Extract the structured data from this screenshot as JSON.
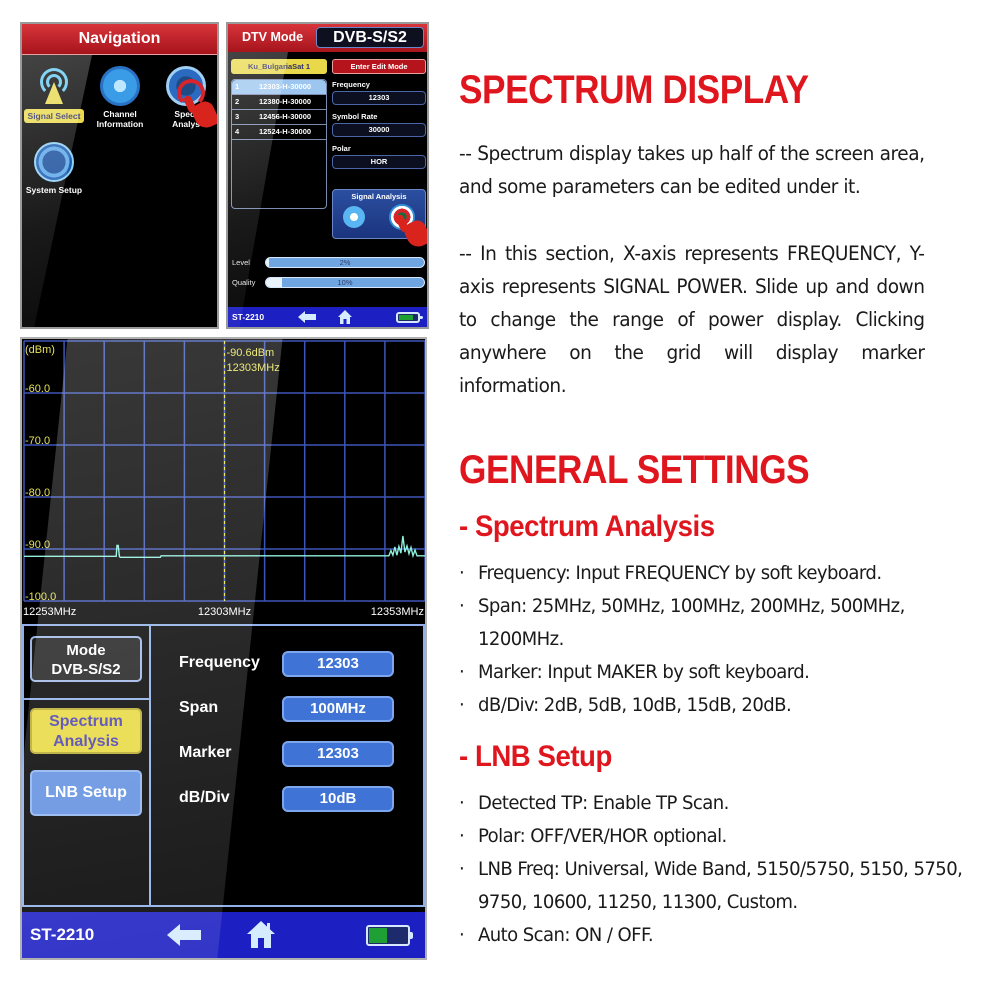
{
  "navigation_screen": {
    "title": "Navigation",
    "items": [
      {
        "label": "Signal Select",
        "icon": "antenna-icon",
        "selected": true
      },
      {
        "label": "Channel Information",
        "icon": "gear-icon",
        "selected": false
      },
      {
        "label": "Spectrum Analysis",
        "icon": "spectrum-icon",
        "selected": false
      },
      {
        "label": "System Setup",
        "icon": "options-icon",
        "selected": false
      }
    ],
    "label_lines": {
      "channel_1": "Channel",
      "channel_2": "Information",
      "spectrum_1": "Spect",
      "spectrum_2": "Analys"
    }
  },
  "dtv_screen": {
    "mode_label": "DTV Mode",
    "mode_value": "DVB-S/S2",
    "satellite": "Ku_BulgariaSat 1",
    "edit_button": "Enter Edit Mode",
    "transponders": [
      {
        "num": "1",
        "value": "12303-H-30000",
        "selected": true
      },
      {
        "num": "2",
        "value": "12380-H-30000",
        "selected": false
      },
      {
        "num": "3",
        "value": "12456-H-30000",
        "selected": false
      },
      {
        "num": "4",
        "value": "12524-H-30000",
        "selected": false
      }
    ],
    "frequency_label": "Frequency",
    "frequency_value": "12303",
    "symbol_rate_label": "Symbol Rate",
    "symbol_rate_value": "30000",
    "polar_label": "Polar",
    "polar_value": "HOR",
    "signal_analysis_label": "Signal Analysis",
    "level_label": "Level",
    "level_text": "2%",
    "level_percent": 2,
    "quality_label": "Quality",
    "quality_text": "10%",
    "quality_percent": 10,
    "model": "ST-2210"
  },
  "spectrum_screen": {
    "mode_title": "Mode",
    "mode_value": "DVB-S/S2",
    "buttons": {
      "spectrum_line1": "Spectrum",
      "spectrum_line2": "Analysis",
      "lnb": "LNB Setup"
    },
    "settings": [
      {
        "label": "Frequency",
        "value": "12303"
      },
      {
        "label": "Span",
        "value": "100MHz"
      },
      {
        "label": "Marker",
        "value": "12303"
      },
      {
        "label": "dB/Div",
        "value": "10dB"
      }
    ],
    "model": "ST-2210",
    "battery_level": 0.5
  },
  "chart_data": {
    "type": "line",
    "title": "",
    "ylabel": "(dBm)",
    "xlabel": "",
    "ylim": [
      -100,
      -50
    ],
    "xlim": [
      12253,
      12353
    ],
    "yticks": [
      -60,
      -70,
      -80,
      -90,
      -100
    ],
    "ytick_labels": [
      "-60.0",
      "-70.0",
      "-80.0",
      "-90.0",
      "-100.0"
    ],
    "xtick_labels": [
      "12253MHz",
      "12303MHz",
      "12353MHz"
    ],
    "grid": true,
    "grid_divisions_x": 10,
    "marker": {
      "frequency": 12303,
      "level_text": "-90.6dBm",
      "freq_text": "12303MHz"
    },
    "series": [
      {
        "name": "spectrum",
        "color": "#8ff0dc",
        "x": [
          12253,
          12275.5,
          12276,
          12276.2,
          12276.5,
          12276.8,
          12277,
          12287,
          12287.2,
          12344,
          12344.5,
          12345,
          12345.5,
          12346,
          12346.5,
          12347,
          12347.5,
          12348,
          12348.5,
          12349,
          12349.5,
          12350,
          12350.5,
          12351,
          12353
        ],
        "y": [
          -91.4,
          -91.4,
          -91.4,
          -89.3,
          -89.3,
          -91.4,
          -91.6,
          -91.6,
          -91.3,
          -91.3,
          -90.3,
          -91.2,
          -89.6,
          -91.2,
          -89.5,
          -90.8,
          -87.5,
          -90.6,
          -89.4,
          -90.9,
          -89.7,
          -91.3,
          -90.2,
          -91.3,
          -91.3
        ]
      }
    ]
  },
  "right_column": {
    "title1": "SPECTRUM DISPLAY",
    "para1": "-- Spectrum  display takes up half of the screen area, and some parameters can be edited under it.",
    "para2": "-- In this section, X-axis represents FREQUENCY, Y-axis  represents SIGNAL POWER. Slide up and down to  change  the  range of  power display. Clicking anywhere on the grid will display marker information.",
    "title2": "GENERAL SETTINGS",
    "sub1": "- Spectrum Analysis",
    "spectrum_bullets": [
      "Frequency: Input FREQUENCY by soft keyboard.",
      "Span: 25MHz, 50MHz, 100MHz, 200MHz, 500MHz, 1200MHz.",
      "Marker: Input MAKER by soft keyboard.",
      "dB/Div: 2dB, 5dB, 10dB, 15dB, 20dB."
    ],
    "sub2": "-  LNB Setup",
    "lnb_bullets": [
      "Detected TP: Enable TP Scan.",
      "Polar: OFF/VER/HOR optional.",
      "LNB Freq: Universal, Wide Band, 5150/5750, 5150, 5750, 9750, 10600, 11250, 11300, Custom.",
      "Auto Scan: ON / OFF."
    ],
    "bullet_char": "·"
  }
}
